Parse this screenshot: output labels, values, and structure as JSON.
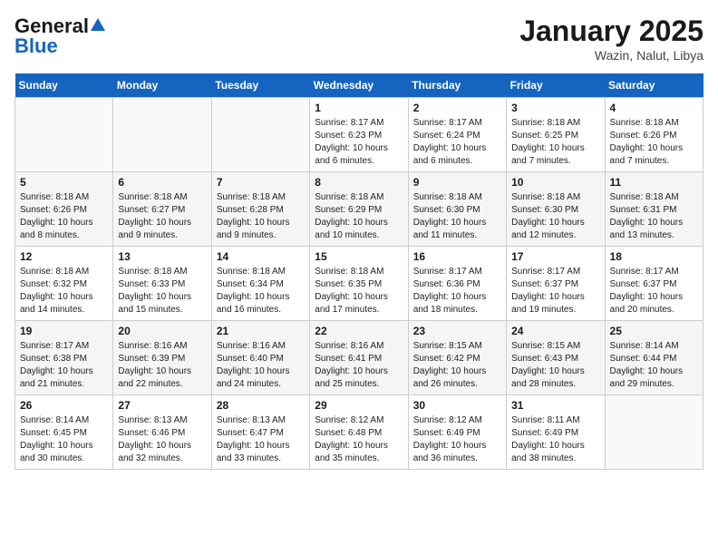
{
  "header": {
    "logo_general": "General",
    "logo_blue": "Blue",
    "month_title": "January 2025",
    "location": "Wazin, Nalut, Libya"
  },
  "weekdays": [
    "Sunday",
    "Monday",
    "Tuesday",
    "Wednesday",
    "Thursday",
    "Friday",
    "Saturday"
  ],
  "weeks": [
    [
      {
        "day": "",
        "info": ""
      },
      {
        "day": "",
        "info": ""
      },
      {
        "day": "",
        "info": ""
      },
      {
        "day": "1",
        "info": "Sunrise: 8:17 AM\nSunset: 6:23 PM\nDaylight: 10 hours\nand 6 minutes."
      },
      {
        "day": "2",
        "info": "Sunrise: 8:17 AM\nSunset: 6:24 PM\nDaylight: 10 hours\nand 6 minutes."
      },
      {
        "day": "3",
        "info": "Sunrise: 8:18 AM\nSunset: 6:25 PM\nDaylight: 10 hours\nand 7 minutes."
      },
      {
        "day": "4",
        "info": "Sunrise: 8:18 AM\nSunset: 6:26 PM\nDaylight: 10 hours\nand 7 minutes."
      }
    ],
    [
      {
        "day": "5",
        "info": "Sunrise: 8:18 AM\nSunset: 6:26 PM\nDaylight: 10 hours\nand 8 minutes."
      },
      {
        "day": "6",
        "info": "Sunrise: 8:18 AM\nSunset: 6:27 PM\nDaylight: 10 hours\nand 9 minutes."
      },
      {
        "day": "7",
        "info": "Sunrise: 8:18 AM\nSunset: 6:28 PM\nDaylight: 10 hours\nand 9 minutes."
      },
      {
        "day": "8",
        "info": "Sunrise: 8:18 AM\nSunset: 6:29 PM\nDaylight: 10 hours\nand 10 minutes."
      },
      {
        "day": "9",
        "info": "Sunrise: 8:18 AM\nSunset: 6:30 PM\nDaylight: 10 hours\nand 11 minutes."
      },
      {
        "day": "10",
        "info": "Sunrise: 8:18 AM\nSunset: 6:30 PM\nDaylight: 10 hours\nand 12 minutes."
      },
      {
        "day": "11",
        "info": "Sunrise: 8:18 AM\nSunset: 6:31 PM\nDaylight: 10 hours\nand 13 minutes."
      }
    ],
    [
      {
        "day": "12",
        "info": "Sunrise: 8:18 AM\nSunset: 6:32 PM\nDaylight: 10 hours\nand 14 minutes."
      },
      {
        "day": "13",
        "info": "Sunrise: 8:18 AM\nSunset: 6:33 PM\nDaylight: 10 hours\nand 15 minutes."
      },
      {
        "day": "14",
        "info": "Sunrise: 8:18 AM\nSunset: 6:34 PM\nDaylight: 10 hours\nand 16 minutes."
      },
      {
        "day": "15",
        "info": "Sunrise: 8:18 AM\nSunset: 6:35 PM\nDaylight: 10 hours\nand 17 minutes."
      },
      {
        "day": "16",
        "info": "Sunrise: 8:17 AM\nSunset: 6:36 PM\nDaylight: 10 hours\nand 18 minutes."
      },
      {
        "day": "17",
        "info": "Sunrise: 8:17 AM\nSunset: 6:37 PM\nDaylight: 10 hours\nand 19 minutes."
      },
      {
        "day": "18",
        "info": "Sunrise: 8:17 AM\nSunset: 6:37 PM\nDaylight: 10 hours\nand 20 minutes."
      }
    ],
    [
      {
        "day": "19",
        "info": "Sunrise: 8:17 AM\nSunset: 6:38 PM\nDaylight: 10 hours\nand 21 minutes."
      },
      {
        "day": "20",
        "info": "Sunrise: 8:16 AM\nSunset: 6:39 PM\nDaylight: 10 hours\nand 22 minutes."
      },
      {
        "day": "21",
        "info": "Sunrise: 8:16 AM\nSunset: 6:40 PM\nDaylight: 10 hours\nand 24 minutes."
      },
      {
        "day": "22",
        "info": "Sunrise: 8:16 AM\nSunset: 6:41 PM\nDaylight: 10 hours\nand 25 minutes."
      },
      {
        "day": "23",
        "info": "Sunrise: 8:15 AM\nSunset: 6:42 PM\nDaylight: 10 hours\nand 26 minutes."
      },
      {
        "day": "24",
        "info": "Sunrise: 8:15 AM\nSunset: 6:43 PM\nDaylight: 10 hours\nand 28 minutes."
      },
      {
        "day": "25",
        "info": "Sunrise: 8:14 AM\nSunset: 6:44 PM\nDaylight: 10 hours\nand 29 minutes."
      }
    ],
    [
      {
        "day": "26",
        "info": "Sunrise: 8:14 AM\nSunset: 6:45 PM\nDaylight: 10 hours\nand 30 minutes."
      },
      {
        "day": "27",
        "info": "Sunrise: 8:13 AM\nSunset: 6:46 PM\nDaylight: 10 hours\nand 32 minutes."
      },
      {
        "day": "28",
        "info": "Sunrise: 8:13 AM\nSunset: 6:47 PM\nDaylight: 10 hours\nand 33 minutes."
      },
      {
        "day": "29",
        "info": "Sunrise: 8:12 AM\nSunset: 6:48 PM\nDaylight: 10 hours\nand 35 minutes."
      },
      {
        "day": "30",
        "info": "Sunrise: 8:12 AM\nSunset: 6:49 PM\nDaylight: 10 hours\nand 36 minutes."
      },
      {
        "day": "31",
        "info": "Sunrise: 8:11 AM\nSunset: 6:49 PM\nDaylight: 10 hours\nand 38 minutes."
      },
      {
        "day": "",
        "info": ""
      }
    ]
  ]
}
